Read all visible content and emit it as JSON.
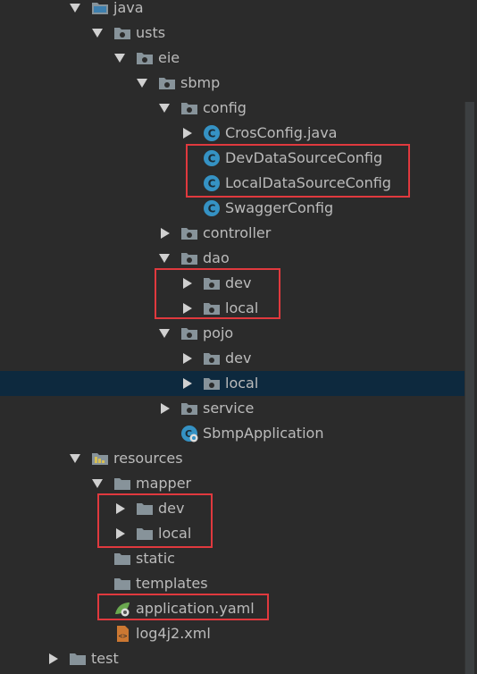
{
  "tree": {
    "rows": [
      {
        "label": "java",
        "icon": "folder-source-icon",
        "arrow": "down"
      },
      {
        "label": "usts",
        "icon": "package-icon",
        "arrow": "down"
      },
      {
        "label": "eie",
        "icon": "package-icon",
        "arrow": "down"
      },
      {
        "label": "sbmp",
        "icon": "package-icon",
        "arrow": "down"
      },
      {
        "label": "config",
        "icon": "package-icon",
        "arrow": "down"
      },
      {
        "label": "CrosConfig.java",
        "icon": "java-class-icon",
        "arrow": "right"
      },
      {
        "label": "DevDataSourceConfig",
        "icon": "java-class-icon",
        "arrow": "none"
      },
      {
        "label": "LocalDataSourceConfig",
        "icon": "java-class-icon",
        "arrow": "none"
      },
      {
        "label": "SwaggerConfig",
        "icon": "java-class-icon",
        "arrow": "none"
      },
      {
        "label": "controller",
        "icon": "package-icon",
        "arrow": "right"
      },
      {
        "label": "dao",
        "icon": "package-icon",
        "arrow": "down"
      },
      {
        "label": "dev",
        "icon": "package-icon",
        "arrow": "right"
      },
      {
        "label": "local",
        "icon": "package-icon",
        "arrow": "right"
      },
      {
        "label": "pojo",
        "icon": "package-icon",
        "arrow": "down"
      },
      {
        "label": "dev",
        "icon": "package-icon",
        "arrow": "right"
      },
      {
        "label": "local",
        "icon": "package-icon",
        "arrow": "right",
        "selected": true
      },
      {
        "label": "service",
        "icon": "package-icon",
        "arrow": "right"
      },
      {
        "label": "SbmpApplication",
        "icon": "spring-boot-class-icon",
        "arrow": "none"
      },
      {
        "label": "resources",
        "icon": "folder-resources-icon",
        "arrow": "down"
      },
      {
        "label": "mapper",
        "icon": "folder-icon",
        "arrow": "down"
      },
      {
        "label": "dev",
        "icon": "folder-icon",
        "arrow": "right"
      },
      {
        "label": "local",
        "icon": "folder-icon",
        "arrow": "right"
      },
      {
        "label": "static",
        "icon": "folder-icon",
        "arrow": "none"
      },
      {
        "label": "templates",
        "icon": "folder-icon",
        "arrow": "none"
      },
      {
        "label": "application.yaml",
        "icon": "spring-yaml-icon",
        "arrow": "none"
      },
      {
        "label": "log4j2.xml",
        "icon": "xml-file-icon",
        "arrow": "none"
      },
      {
        "label": "test",
        "icon": "folder-icon",
        "arrow": "right"
      }
    ]
  },
  "colors": {
    "background": "#2b2b2b",
    "selection": "#0d293e",
    "highlight_border": "#e0393e",
    "text": "#bbbbbb",
    "folder_icon": "#87939a",
    "class_icon": "#3592c4"
  }
}
